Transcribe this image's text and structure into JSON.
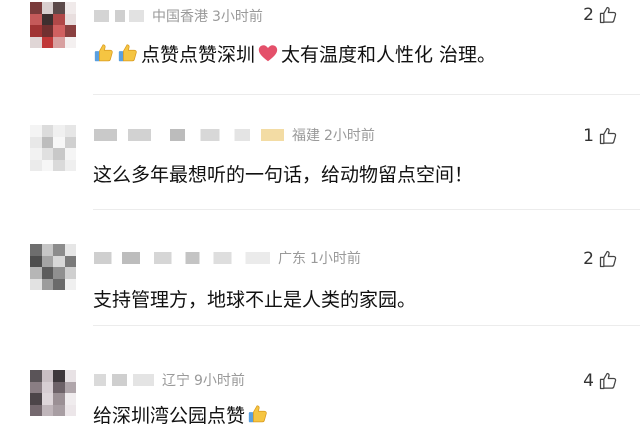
{
  "comments": [
    {
      "location": "中国香港",
      "time": "3小时前",
      "likes": "2",
      "text_main": "点赞点赞深圳",
      "text_after": "太有温度和人性化 治理。",
      "avatar_colors": [
        "#7a3b3b",
        "#d9cfcf",
        "#5c4a4a",
        "#f0eaea",
        "#c45a5a",
        "#3d2f2f",
        "#b04848",
        "#e8dede",
        "#a03434",
        "#703030",
        "#d06060",
        "#8a4040",
        "#e0d6d6",
        "#c03838",
        "#d8a0a0",
        "#f4f0f0"
      ]
    },
    {
      "location": "福建",
      "time": "2小时前",
      "likes": "1",
      "text_main": "这么多年最想听的一句话，给动物留点空间！",
      "avatar_colors": [
        "#f4f4f4",
        "#dcdcdc",
        "#f0f0f0",
        "#e6e6e6",
        "#e8e8e8",
        "#bdbdbd",
        "#f7f7f7",
        "#d0d0d0",
        "#f2f2f2",
        "#e0e0e0",
        "#c8c8c8",
        "#f5f5f5",
        "#ebebeb",
        "#f6f6f6",
        "#dadada",
        "#efefef"
      ]
    },
    {
      "location": "广东",
      "time": "1小时前",
      "likes": "2",
      "text_main": "支持管理方，地球不止是人类的家园。",
      "avatar_colors": [
        "#6e6e6e",
        "#c6c6c6",
        "#8c8c8c",
        "#e6e6e6",
        "#4e4e4e",
        "#a4a4a4",
        "#d8d8d8",
        "#7a7a7a",
        "#b6b6b6",
        "#5c5c5c",
        "#909090",
        "#cfcfcf",
        "#e2e2e2",
        "#9c9c9c",
        "#6a6a6a",
        "#f0f0f0"
      ]
    },
    {
      "location": "辽宁",
      "time": "9小时前",
      "likes": "4",
      "text_main": "给深圳湾公园点赞",
      "avatar_colors": [
        "#5a5458",
        "#c9bfc4",
        "#3e383c",
        "#e8e2e5",
        "#8a7e84",
        "#d7ced3",
        "#6d6268",
        "#b0a6ab",
        "#4c4549",
        "#ded6da",
        "#9b9095",
        "#f0ecee",
        "#75696f",
        "#c0b6bb",
        "#a89ea3",
        "#ece6e9"
      ]
    }
  ]
}
